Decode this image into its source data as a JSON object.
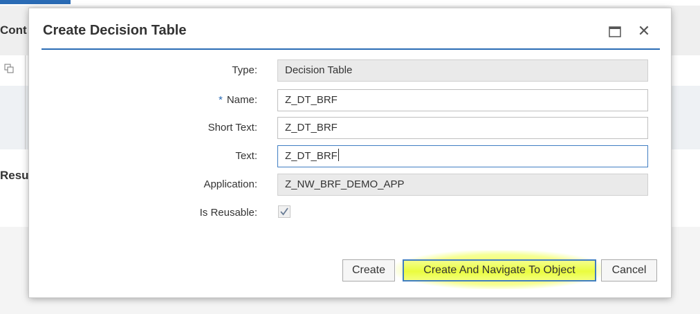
{
  "background": {
    "peek_text_top": "Cont",
    "peek_text_mid": "Resu",
    "copy_icon": "copy-icon"
  },
  "dialog": {
    "title": "Create Decision Table",
    "maximize_icon": "maximize-icon",
    "close_icon": "close-icon",
    "close_glyph": "✕",
    "fields": {
      "type": {
        "label": "Type:",
        "value": "Decision Table",
        "readonly": true
      },
      "name": {
        "label": "Name:",
        "required_mark": "*",
        "value": "Z_DT_BRF"
      },
      "short_text": {
        "label": "Short Text:",
        "value": "Z_DT_BRF"
      },
      "text": {
        "label": "Text:",
        "value": "Z_DT_BRF",
        "focused": true
      },
      "application": {
        "label": "Application:",
        "value": "Z_NW_BRF_DEMO_APP",
        "readonly": true
      },
      "is_reusable": {
        "label": "Is Reusable:",
        "checked": true,
        "disabled": true
      }
    },
    "buttons": {
      "create": "Create",
      "create_navigate": "Create And Navigate To Object",
      "cancel": "Cancel"
    }
  },
  "colors": {
    "accent": "#2a6bb5",
    "focus_border": "#3f7dc2",
    "highlight": "#eefc3e",
    "readonly_bg": "#eaeaea"
  }
}
